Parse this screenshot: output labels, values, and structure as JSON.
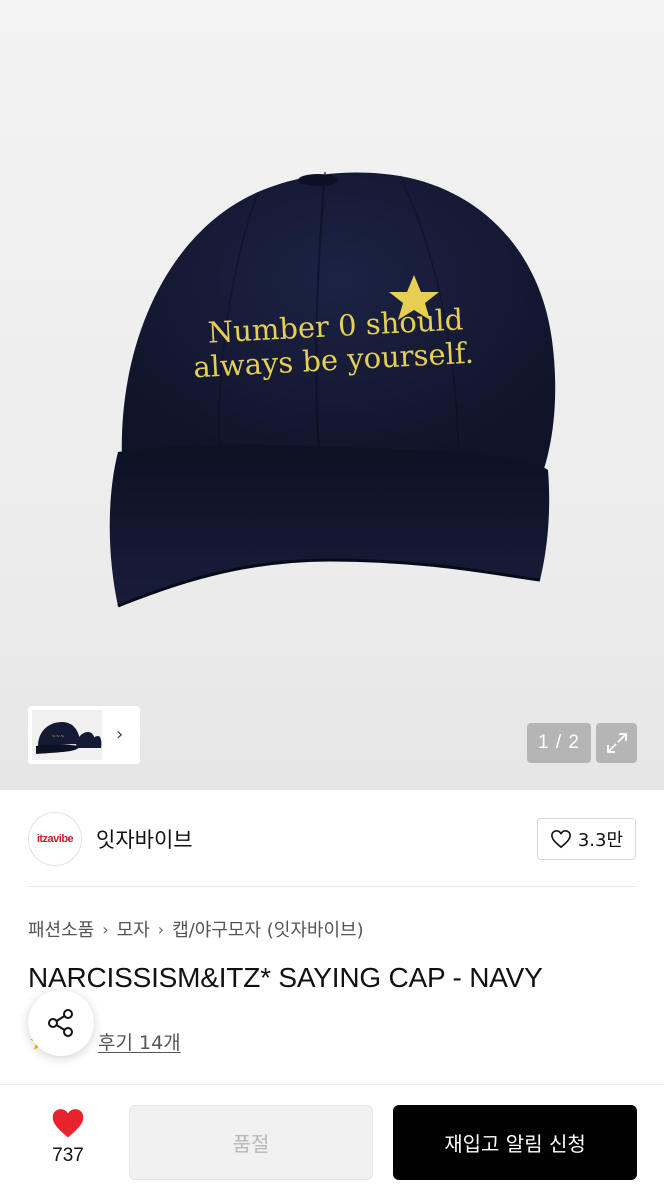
{
  "hero": {
    "cap_text_line1": "Number 0 should",
    "cap_text_line2": "always be yourself.",
    "counter": "1 / 2",
    "thumbnail_chevron": "chevron-right-icon"
  },
  "store": {
    "logo_text": "itzavibe",
    "name": "잇자바이브",
    "likes": "3.3만"
  },
  "breadcrumb": [
    "패션소품",
    "모자",
    "캡/야구모자 (잇자바이브)"
  ],
  "product": {
    "title": "NARCISSISM&ITZ* SAYING CAP - NAVY",
    "reviews_label": "후기 14개"
  },
  "bottom_bar": {
    "wish_count": "737",
    "soldout_label": "품절",
    "restock_label": "재입고 알림 신청"
  },
  "colors": {
    "cap_navy": "#141a33",
    "embroidery_yellow": "#e6cf52",
    "heart_red": "#e8232d",
    "brand_red": "#c8202f"
  }
}
